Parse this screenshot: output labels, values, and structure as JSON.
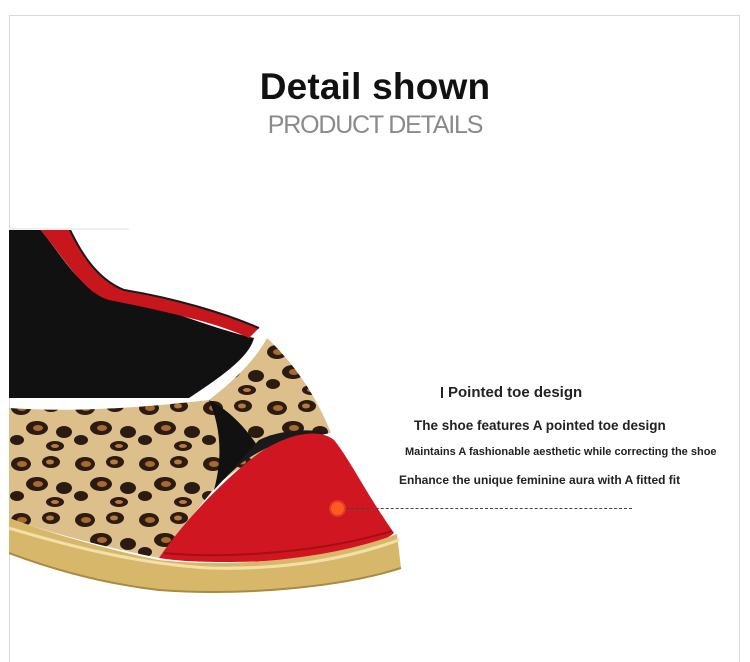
{
  "header": {
    "title": "Detail shown",
    "subtitle": "PRODUCT DETAILS"
  },
  "product_image": {
    "icon": "leopard-print-peep-toe-platform-sandal"
  },
  "callout": {
    "heading": "Pointed toe design",
    "lines": [
      "The shoe features A pointed toe design",
      "Maintains A fashionable aesthetic while correcting the shoe",
      "Enhance the unique feminine aura with A fitted fit"
    ],
    "marker_color": "#ff5a1f"
  }
}
